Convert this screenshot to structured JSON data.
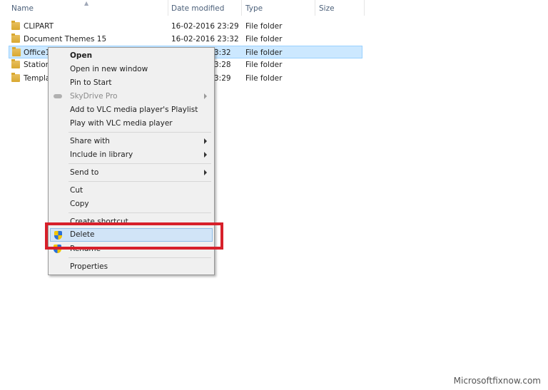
{
  "columns": {
    "name": "Name",
    "date": "Date modified",
    "type": "Type",
    "size": "Size"
  },
  "rows": [
    {
      "name": "CLIPART",
      "date": "16-02-2016 23:29",
      "type": "File folder"
    },
    {
      "name": "Document Themes 15",
      "date": "16-02-2016 23:32",
      "type": "File folder"
    },
    {
      "name": "Office1",
      "date": "3:32",
      "type": "File folder",
      "selected": true
    },
    {
      "name": "Statione",
      "date": "3:28",
      "type": "File folder"
    },
    {
      "name": "Templa",
      "date": "3:29",
      "type": "File folder"
    }
  ],
  "menu": {
    "items": [
      {
        "label": "Open",
        "bold": true
      },
      {
        "label": "Open in new window"
      },
      {
        "label": "Pin to Start"
      },
      {
        "label": "SkyDrive Pro",
        "disabled": true,
        "submenu": true,
        "icon": "cloud-icon"
      },
      {
        "label": "Add to VLC media player's Playlist"
      },
      {
        "label": "Play with VLC media player"
      },
      {
        "label": "Share with",
        "submenu": true
      },
      {
        "label": "Include in library",
        "submenu": true
      },
      {
        "label": "Send to",
        "submenu": true
      },
      {
        "label": "Cut"
      },
      {
        "label": "Copy"
      },
      {
        "label": "Create shortcut"
      },
      {
        "label": "Delete",
        "icon": "shield-icon",
        "highlighted": true
      },
      {
        "label": "Rename",
        "icon": "shield-icon"
      },
      {
        "label": "Properties"
      }
    ]
  },
  "highlight_color": "#d7202a",
  "watermark": "Microsoftfixnow.com"
}
